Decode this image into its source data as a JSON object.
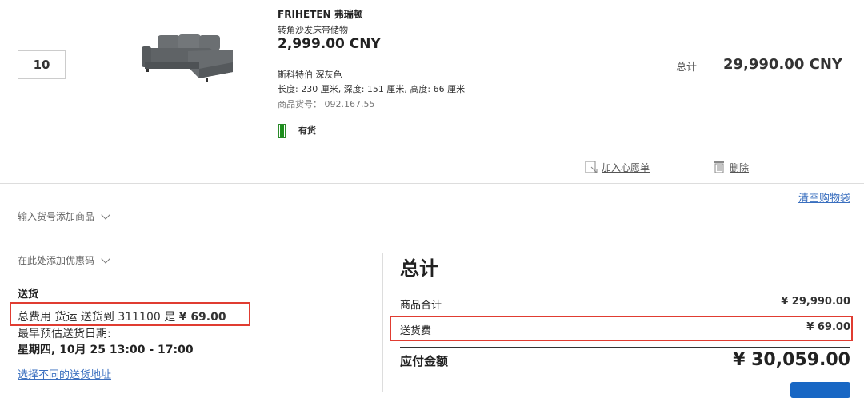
{
  "cart_item": {
    "quantity": "10",
    "product_image": "sofa-bed-thumbnail",
    "name": "FRIHETEN 弗瑞顿",
    "description": "转角沙发床带储物",
    "unit_price": "2,999.00 CNY",
    "color": "斯科特伯 深灰色",
    "dimensions": "长度: 230 厘米, 深度: 151 厘米, 高度: 66 厘米",
    "article_label": "商品货号：",
    "article_number": "092.167.55",
    "stock_status": "有货",
    "stock_color": "#1d8f1d",
    "total_label": "总计",
    "total_value": "29,990.00 CNY",
    "wishlist_label": "加入心愿单",
    "delete_label": "删除"
  },
  "cart_actions": {
    "clear_cart": "清空购物袋",
    "add_by_article": "输入货号添加商品",
    "add_coupon": "在此处添加优惠码"
  },
  "delivery": {
    "title": "送货",
    "fee_text": "总费用 货运 送货到 311100 是 ",
    "fee_amount": "¥ 69.00",
    "estimate_label": "最早预估送货日期:",
    "estimate_value": "星期四, 10月 25 13:00 - 17:00",
    "change_address": "选择不同的送货地址"
  },
  "summary": {
    "title": "总计",
    "subtotal_label": "商品合计",
    "subtotal_value": "¥ 29,990.00",
    "shipping_label": "送货费",
    "shipping_value": "¥ 69.00",
    "payable_label": "应付金额",
    "payable_value": "¥ 30,059.00"
  },
  "colors": {
    "highlight_border": "#e03c31",
    "link": "#3a6fbf",
    "checkout_button": "#1867c4"
  }
}
